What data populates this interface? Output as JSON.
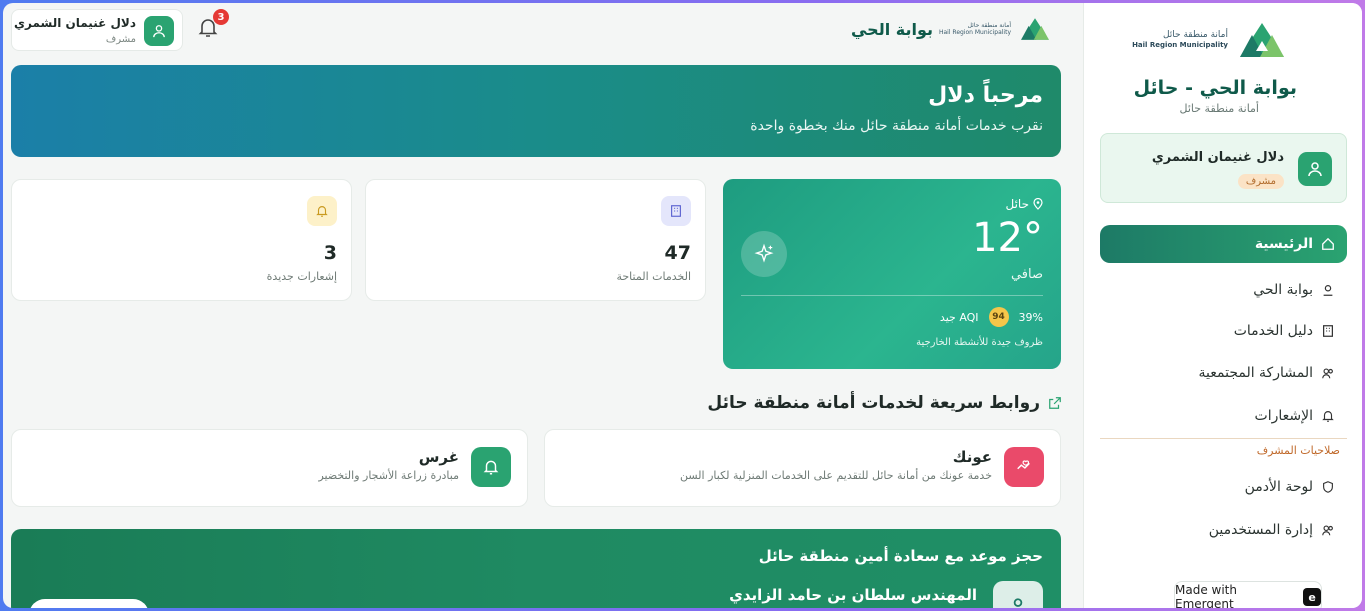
{
  "sidebar": {
    "logo_ar": "أمانة منطقة حائل",
    "logo_en": "Hail Region Municipality",
    "title": "بوابة الحي - حائل",
    "subtitle": "أمانة منطقة حائل",
    "user": {
      "name": "دلال غنيمان الشمري",
      "role": "مشرف"
    },
    "items": [
      {
        "label": "الرئيسية",
        "icon": "home-icon"
      },
      {
        "label": "بوابة الحي",
        "icon": "user-pin-icon"
      },
      {
        "label": "دليل الخدمات",
        "icon": "building-icon"
      },
      {
        "label": "المشاركة المجتمعية",
        "icon": "people-icon"
      },
      {
        "label": "الإشعارات",
        "icon": "bell-icon"
      }
    ],
    "section_label": "صلاحيات المشرف",
    "admin_items": [
      {
        "label": "لوحة الأدمن",
        "icon": "shield-icon"
      },
      {
        "label": "إدارة المستخدمين",
        "icon": "users-icon"
      }
    ],
    "made_with": "Made with Emergent"
  },
  "topbar": {
    "user_name": "دلال غنيمان الشمري",
    "user_role": "مشرف",
    "notifications_count": "3",
    "brand_title": "بوابة الحي",
    "brand_small_ar": "أمانة منطقة حائل",
    "brand_small_en": "Hail Region Municipality"
  },
  "hero": {
    "title": "مرحباً دلال",
    "subtitle": "نقرب خدمات أمانة منطقة حائل منك بخطوة واحدة"
  },
  "weather": {
    "city": "حائل",
    "temp": "12°",
    "condition": "صافي",
    "humidity": "39%",
    "aqi_value": "94",
    "aqi_label": "AQI جيد",
    "note": "ظروف جيدة للأنشطة الخارجية"
  },
  "stats": [
    {
      "value": "47",
      "label": "الخدمات المتاحة",
      "icon": "building-icon",
      "color": "#e4e6fb"
    },
    {
      "value": "3",
      "label": "إشعارات جديدة",
      "icon": "bell-icon",
      "color": "#fdf1c9"
    }
  ],
  "quick_links": {
    "title": "روابط سريعة لخدمات أمانة منطقة حائل",
    "items": [
      {
        "title": "عونك",
        "desc": "خدمة عونك من أمانة حائل للتقديم على الخدمات المنزلية لكبار السن",
        "icon": "hand-heart-icon",
        "color": "#ea4a6a"
      },
      {
        "title": "غرس",
        "desc": "مبادرة زراعة الأشجار والتخضير",
        "icon": "bell-icon",
        "color": "#2aa371"
      }
    ]
  },
  "booking": {
    "title": "حجز موعد مع سعادة أمين منطقة حائل",
    "person": "المهندس سلطان بن حامد الزايدي"
  },
  "colors": {
    "primary": "#1d7a66",
    "accent": "#2aa371",
    "badge": "#e53935"
  }
}
